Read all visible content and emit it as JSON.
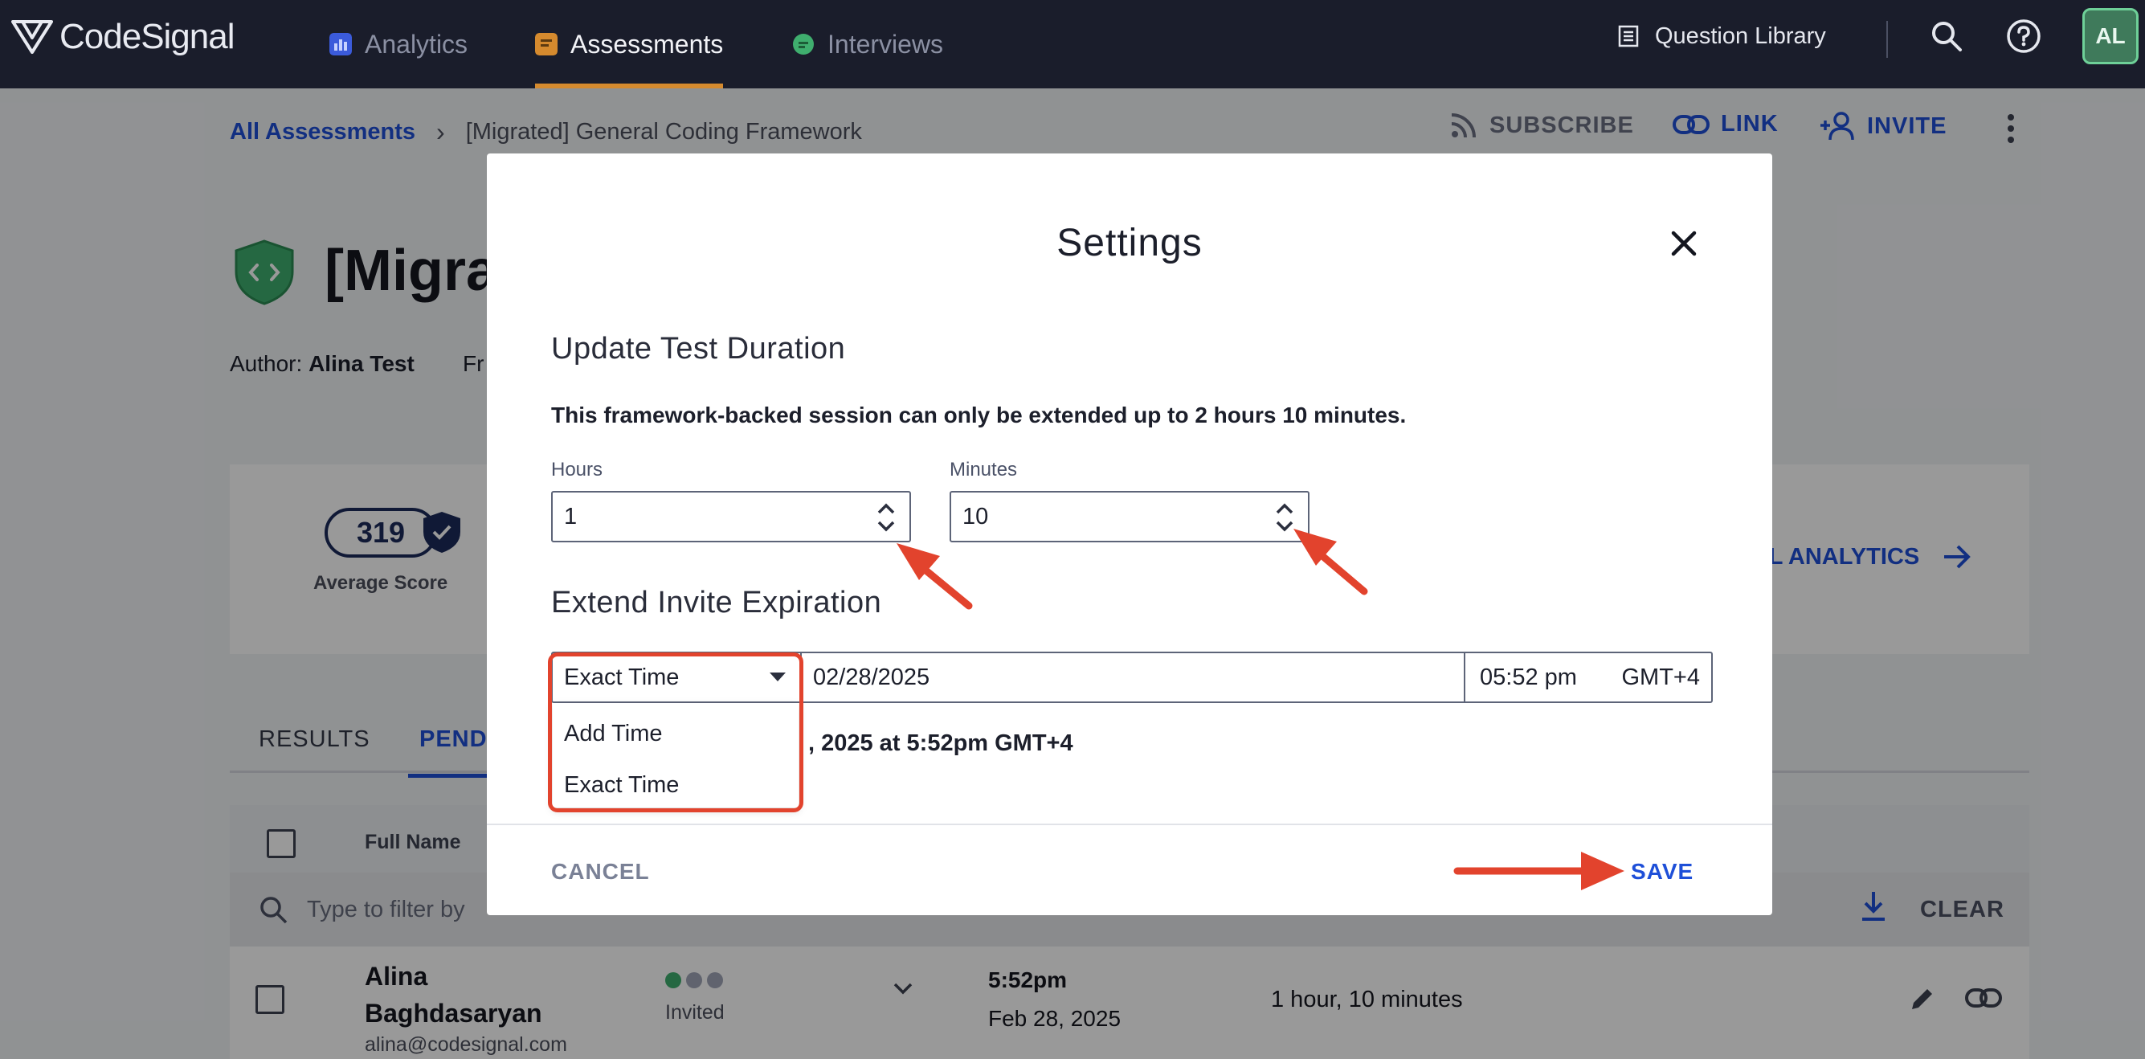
{
  "brand": {
    "name": "CodeSignal"
  },
  "nav": {
    "tabs": [
      {
        "label": "Analytics",
        "icon": "bar-chart-icon",
        "color": "#3b5bdb"
      },
      {
        "label": "Assessments",
        "icon": "document-icon",
        "color": "#d58a2e"
      },
      {
        "label": "Interviews",
        "icon": "chat-bubble-icon",
        "color": "#3fae6e"
      }
    ],
    "question_library": "Question Library",
    "avatar_initials": "AL"
  },
  "breadcrumb": {
    "root": "All Assessments",
    "current": "[Migrated] General Coding Framework"
  },
  "header_actions": {
    "subscribe": "SUBSCRIBE",
    "link": "LINK",
    "invite": "INVITE"
  },
  "assessment": {
    "title_visible": "[Migra",
    "author_label": "Author:",
    "author_name": "Alina Test",
    "author_extra": "Fr"
  },
  "stats": {
    "average_score": "319",
    "average_score_label": "Average Score",
    "all_analytics": "LL ANALYTICS"
  },
  "tabs": {
    "results": "RESULTS",
    "pending": "PEND"
  },
  "table": {
    "header_name": "Full Name",
    "filter_placeholder": "Type to filter by",
    "clear": "CLEAR",
    "rows": [
      {
        "name_line1": "Alina",
        "name_line2": "Baghdasaryan",
        "email": "alina@codesignal.com",
        "status": "Invited",
        "time": "5:52pm",
        "date": "Feb 28, 2025",
        "duration": "1 hour, 10 minutes"
      }
    ]
  },
  "modal": {
    "title": "Settings",
    "duration_section": "Update Test Duration",
    "notice": "This framework-backed session can only be extended up to 2 hours 10 minutes.",
    "hours_label": "Hours",
    "hours_value": "1",
    "minutes_label": "Minutes",
    "minutes_value": "10",
    "expiration_section": "Extend Invite Expiration",
    "mode_selected": "Exact Time",
    "mode_options": [
      "Add Time",
      "Exact Time"
    ],
    "date_value": "02/28/2025",
    "time_value": "05:52 pm",
    "timezone": "GMT+4",
    "expiry_text": ", 2025 at 5:52pm GMT+4",
    "cancel": "CANCEL",
    "save": "SAVE"
  },
  "colors": {
    "accent": "#1e4fd8",
    "annotation_red": "#e2432d",
    "nav_bg": "#1a1d2b",
    "brand_green": "#3fae6e"
  }
}
